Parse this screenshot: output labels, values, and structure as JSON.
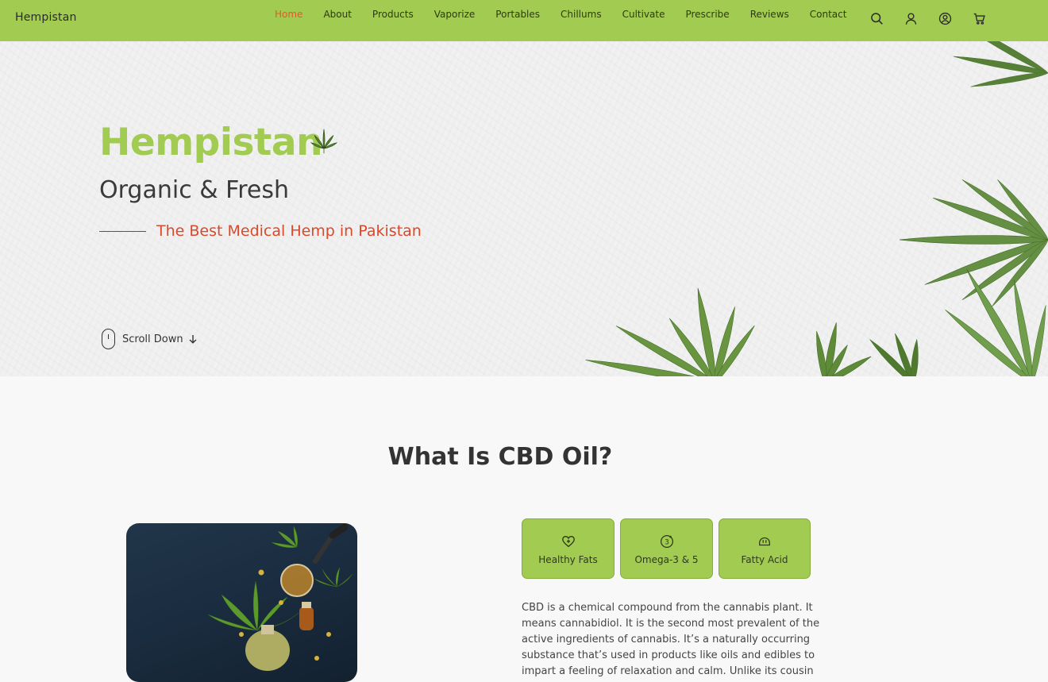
{
  "header": {
    "brand": "Hempistan",
    "nav": [
      {
        "label": "Home",
        "active": true
      },
      {
        "label": "About"
      },
      {
        "label": "Products"
      },
      {
        "label": "Vaporize"
      },
      {
        "label": "Portables"
      },
      {
        "label": "Chillums"
      },
      {
        "label": "Cultivate"
      },
      {
        "label": "Prescribe"
      },
      {
        "label": "Reviews"
      },
      {
        "label": "Contact"
      }
    ],
    "icons": [
      "search-icon",
      "user-icon",
      "account-circle-icon",
      "cart-icon"
    ]
  },
  "hero": {
    "title": "Hempistan",
    "title_icon": "cannabis-leaf-icon",
    "subtitle": "Organic & Fresh",
    "tagline": "The Best Medical Hemp in Pakistan",
    "scroll_label": "Scroll Down"
  },
  "about": {
    "heading": "What Is CBD Oil?",
    "features": [
      {
        "label": "Healthy Fats",
        "icon": "heart-plus-icon"
      },
      {
        "label": "Omega-3 & 5",
        "icon": "omega-three-icon"
      },
      {
        "label": "Fatty Acid",
        "icon": "acid-icon"
      }
    ],
    "description": "CBD is a chemical compound from the cannabis plant. It means cannabidiol. It is the second most prevalent of the active ingredients of cannabis. It’s a naturally occurring substance that’s used in products like oils and edibles to impart a feeling of relaxation and calm. Unlike its cousin"
  },
  "colors": {
    "brand_green": "#a2cb52",
    "accent_red": "#d9492a",
    "nav_active": "#e5582a"
  }
}
